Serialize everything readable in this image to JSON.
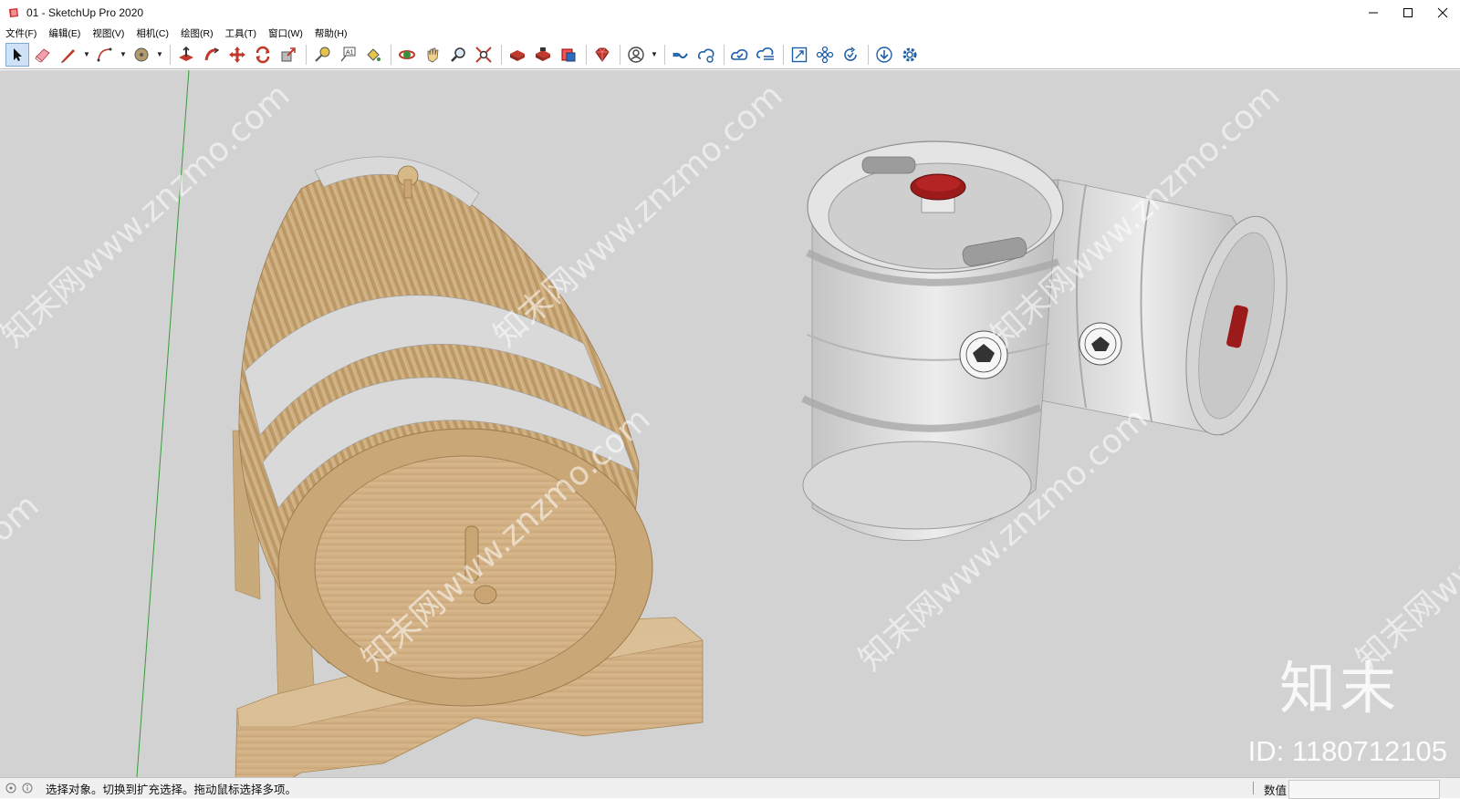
{
  "window": {
    "title": "01 - SketchUp Pro 2020"
  },
  "menu": [
    {
      "label": "文件(F)"
    },
    {
      "label": "编辑(E)"
    },
    {
      "label": "视图(V)"
    },
    {
      "label": "相机(C)"
    },
    {
      "label": "绘图(R)"
    },
    {
      "label": "工具(T)"
    },
    {
      "label": "窗口(W)"
    },
    {
      "label": "帮助(H)"
    }
  ],
  "toolbar": {
    "tools": [
      "select-icon",
      "eraser-icon",
      "line-pencil-icon",
      "arc-icon",
      "paint-bucket-icon",
      "push-pull-icon",
      "follow-me-icon",
      "move-icon",
      "rotate-icon",
      "scale-icon",
      "tape-measure-icon",
      "text-icon",
      "paint-icon",
      "orbit-icon",
      "pan-icon",
      "zoom-icon",
      "zoom-extents-icon",
      "warehouse-icon",
      "extension-warehouse-icon",
      "layout-icon",
      "ruby-icon",
      "account-icon",
      "trimble-connect-icon",
      "collaborate-icon",
      "cloud-sync-icon",
      "cloud-list-icon",
      "resize-icon",
      "components-icon",
      "refresh-check-icon",
      "download-icon",
      "settings-icon"
    ]
  },
  "viewport": {
    "watermark_text": "知末网www.znzmo.com",
    "logo_text": "知末",
    "id_text": "ID: 1180712105"
  },
  "status": {
    "hint": "选择对象。切换到扩充选择。拖动鼠标选择多项。",
    "measure_label": "数值",
    "measure_value": ""
  },
  "colors": {
    "viewport_bg": "#d2d2d2",
    "wood": "#c9a878",
    "steel": "#d6d6d6",
    "keg_cap": "#9b1b1b"
  }
}
